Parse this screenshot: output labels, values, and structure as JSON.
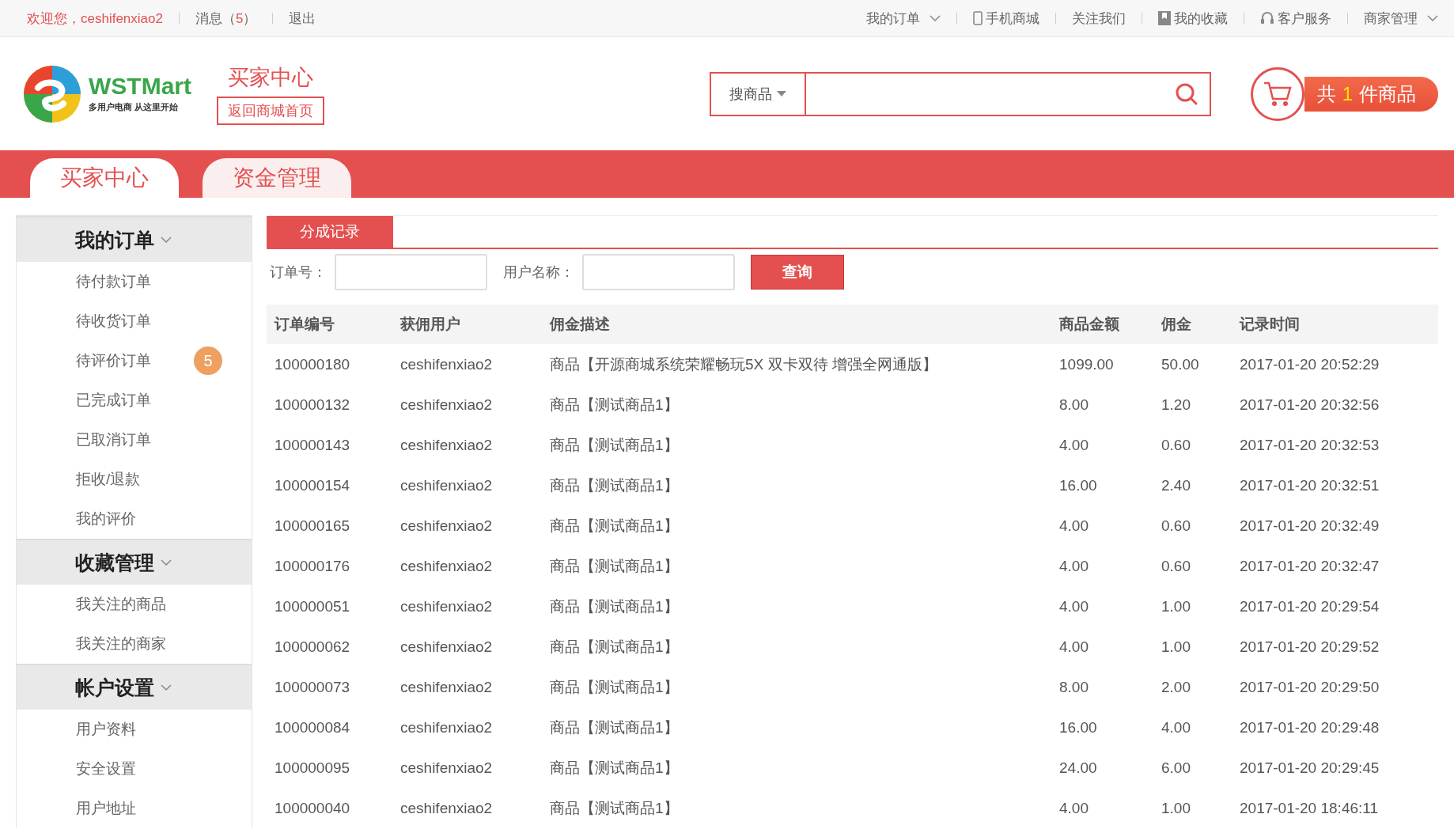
{
  "top_bar": {
    "welcome": "欢迎您，",
    "username": "ceshifenxiao2",
    "messages_label": "消息（",
    "messages_count": "5",
    "messages_close": "）",
    "logout": "退出",
    "links": [
      {
        "label": "我的订单",
        "kind": "plain",
        "dropdown": true
      },
      {
        "label": "手机商城",
        "kind": "phone",
        "dropdown": false
      },
      {
        "label": "关注我们",
        "kind": "plain",
        "dropdown": false
      },
      {
        "label": "我的收藏",
        "kind": "bookmark",
        "dropdown": false
      },
      {
        "label": "客户服务",
        "kind": "headset",
        "dropdown": false
      },
      {
        "label": "商家管理",
        "kind": "plain",
        "dropdown": true
      }
    ]
  },
  "header": {
    "logo_text": "WSTMart",
    "logo_slogan": "多用户电商 从这里开始",
    "center_title": "买家中心",
    "home_link": "返回商城首页",
    "search": {
      "category": "搜商品"
    },
    "cart": {
      "prefix": "共",
      "count": "1",
      "suffix": "件商品"
    }
  },
  "nav_tabs": [
    {
      "label": "买家中心",
      "selected": true
    },
    {
      "label": "资金管理",
      "selected": false
    }
  ],
  "sidebar": [
    {
      "title": "我的订单",
      "items": [
        {
          "label": "待付款订单"
        },
        {
          "label": "待收货订单"
        },
        {
          "label": "待评价订单",
          "badge": "5"
        },
        {
          "label": "已完成订单"
        },
        {
          "label": "已取消订单"
        },
        {
          "label": "拒收/退款"
        },
        {
          "label": "我的评价"
        }
      ]
    },
    {
      "title": "收藏管理",
      "items": [
        {
          "label": "我关注的商品"
        },
        {
          "label": "我关注的商家"
        }
      ]
    },
    {
      "title": "帐户设置",
      "items": [
        {
          "label": "用户资料"
        },
        {
          "label": "安全设置"
        },
        {
          "label": "用户地址"
        }
      ]
    }
  ],
  "content": {
    "tab": "分成记录",
    "filters": [
      {
        "label": "订单号："
      },
      {
        "label": "用户名称："
      }
    ],
    "query_button": "查询",
    "table": {
      "columns": [
        "订单编号",
        "获佣用户",
        "佣金描述",
        "商品金额",
        "佣金",
        "记录时间"
      ],
      "rows": [
        [
          "100000180",
          "ceshifenxiao2",
          "商品【开源商城系统荣耀畅玩5X 双卡双待 增强全网通版】",
          "1099.00",
          "50.00",
          "2017-01-20 20:52:29"
        ],
        [
          "100000132",
          "ceshifenxiao2",
          "商品【测试商品1】",
          "8.00",
          "1.20",
          "2017-01-20 20:32:56"
        ],
        [
          "100000143",
          "ceshifenxiao2",
          "商品【测试商品1】",
          "4.00",
          "0.60",
          "2017-01-20 20:32:53"
        ],
        [
          "100000154",
          "ceshifenxiao2",
          "商品【测试商品1】",
          "16.00",
          "2.40",
          "2017-01-20 20:32:51"
        ],
        [
          "100000165",
          "ceshifenxiao2",
          "商品【测试商品1】",
          "4.00",
          "0.60",
          "2017-01-20 20:32:49"
        ],
        [
          "100000176",
          "ceshifenxiao2",
          "商品【测试商品1】",
          "4.00",
          "0.60",
          "2017-01-20 20:32:47"
        ],
        [
          "100000051",
          "ceshifenxiao2",
          "商品【测试商品1】",
          "4.00",
          "1.00",
          "2017-01-20 20:29:54"
        ],
        [
          "100000062",
          "ceshifenxiao2",
          "商品【测试商品1】",
          "4.00",
          "1.00",
          "2017-01-20 20:29:52"
        ],
        [
          "100000073",
          "ceshifenxiao2",
          "商品【测试商品1】",
          "8.00",
          "2.00",
          "2017-01-20 20:29:50"
        ],
        [
          "100000084",
          "ceshifenxiao2",
          "商品【测试商品1】",
          "16.00",
          "4.00",
          "2017-01-20 20:29:48"
        ],
        [
          "100000095",
          "ceshifenxiao2",
          "商品【测试商品1】",
          "24.00",
          "6.00",
          "2017-01-20 20:29:45"
        ],
        [
          "100000040",
          "ceshifenxiao2",
          "商品【测试商品1】",
          "4.00",
          "1.00",
          "2017-01-20 18:46:11"
        ]
      ]
    }
  }
}
